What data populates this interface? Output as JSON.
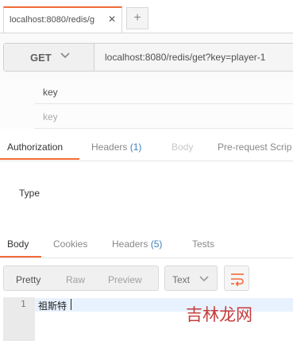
{
  "tab": {
    "title": "localhost:8080/redis/g",
    "close": "×",
    "new_tab": "+"
  },
  "request": {
    "method": "GET",
    "url": "localhost:8080/redis/get?key=player-1"
  },
  "params": {
    "rows": [
      {
        "key": "key"
      }
    ],
    "placeholder": "key"
  },
  "request_tabs": {
    "authorization": "Authorization",
    "headers": "Headers",
    "headers_count": "(1)",
    "body": "Body",
    "pre_request": "Pre-request Scrip"
  },
  "auth": {
    "type_label": "Type"
  },
  "response_tabs": {
    "body": "Body",
    "cookies": "Cookies",
    "headers": "Headers",
    "headers_count": "(5)",
    "tests": "Tests"
  },
  "response_toolbar": {
    "pretty": "Pretty",
    "raw": "Raw",
    "preview": "Preview",
    "format": "Text"
  },
  "response_body": {
    "line_number": "1",
    "text": "祖斯特"
  },
  "watermark": {
    "text": "吉林龙网"
  },
  "colors": {
    "accent": "#f26b3a",
    "count": "#3f7fc0",
    "watermark": "#c43c3c"
  },
  "icons": {
    "close": "close-icon",
    "method_dropdown": "chevron-down-icon",
    "format_dropdown": "chevron-down-icon",
    "wrap": "wrap-lines-icon"
  }
}
